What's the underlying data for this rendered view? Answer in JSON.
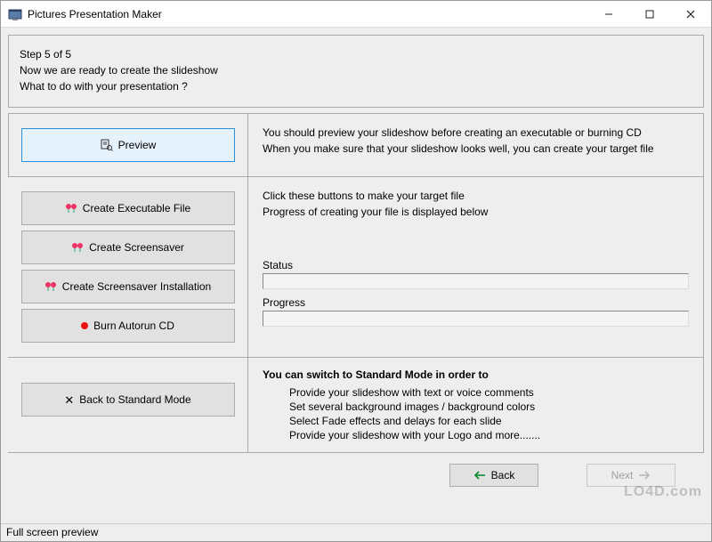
{
  "window": {
    "title": "Pictures Presentation Maker"
  },
  "header": {
    "step": "Step 5 of 5",
    "ready": "Now we are ready to create the slideshow",
    "question": "What to do with your presentation ?"
  },
  "buttons": {
    "preview": "Preview",
    "create_exe": "Create Executable File",
    "create_scr": "Create Screensaver",
    "create_scr_install": "Create Screensaver Installation",
    "burn_cd": "Burn Autorun CD",
    "back_standard": "Back to Standard Mode"
  },
  "right": {
    "preview1": "You should preview your slideshow before creating an executable or burning CD",
    "preview2": "When you make sure that your slideshow looks well, you can create your target file",
    "target1": "Click these buttons to make your target file",
    "target2": "Progress of creating your file is displayed below",
    "status_label": "Status",
    "progress_label": "Progress",
    "std_bold": "You can switch to Standard Mode in order to",
    "std1": "Provide your slideshow with text or voice comments",
    "std2": "Set several background images / background colors",
    "std3": "Select Fade effects and delays for each slide",
    "std4": "Provide your slideshow with your Logo    and more......."
  },
  "nav": {
    "back": "Back",
    "next": "Next"
  },
  "statusbar": "Full screen preview",
  "watermark": "LO4D.com"
}
